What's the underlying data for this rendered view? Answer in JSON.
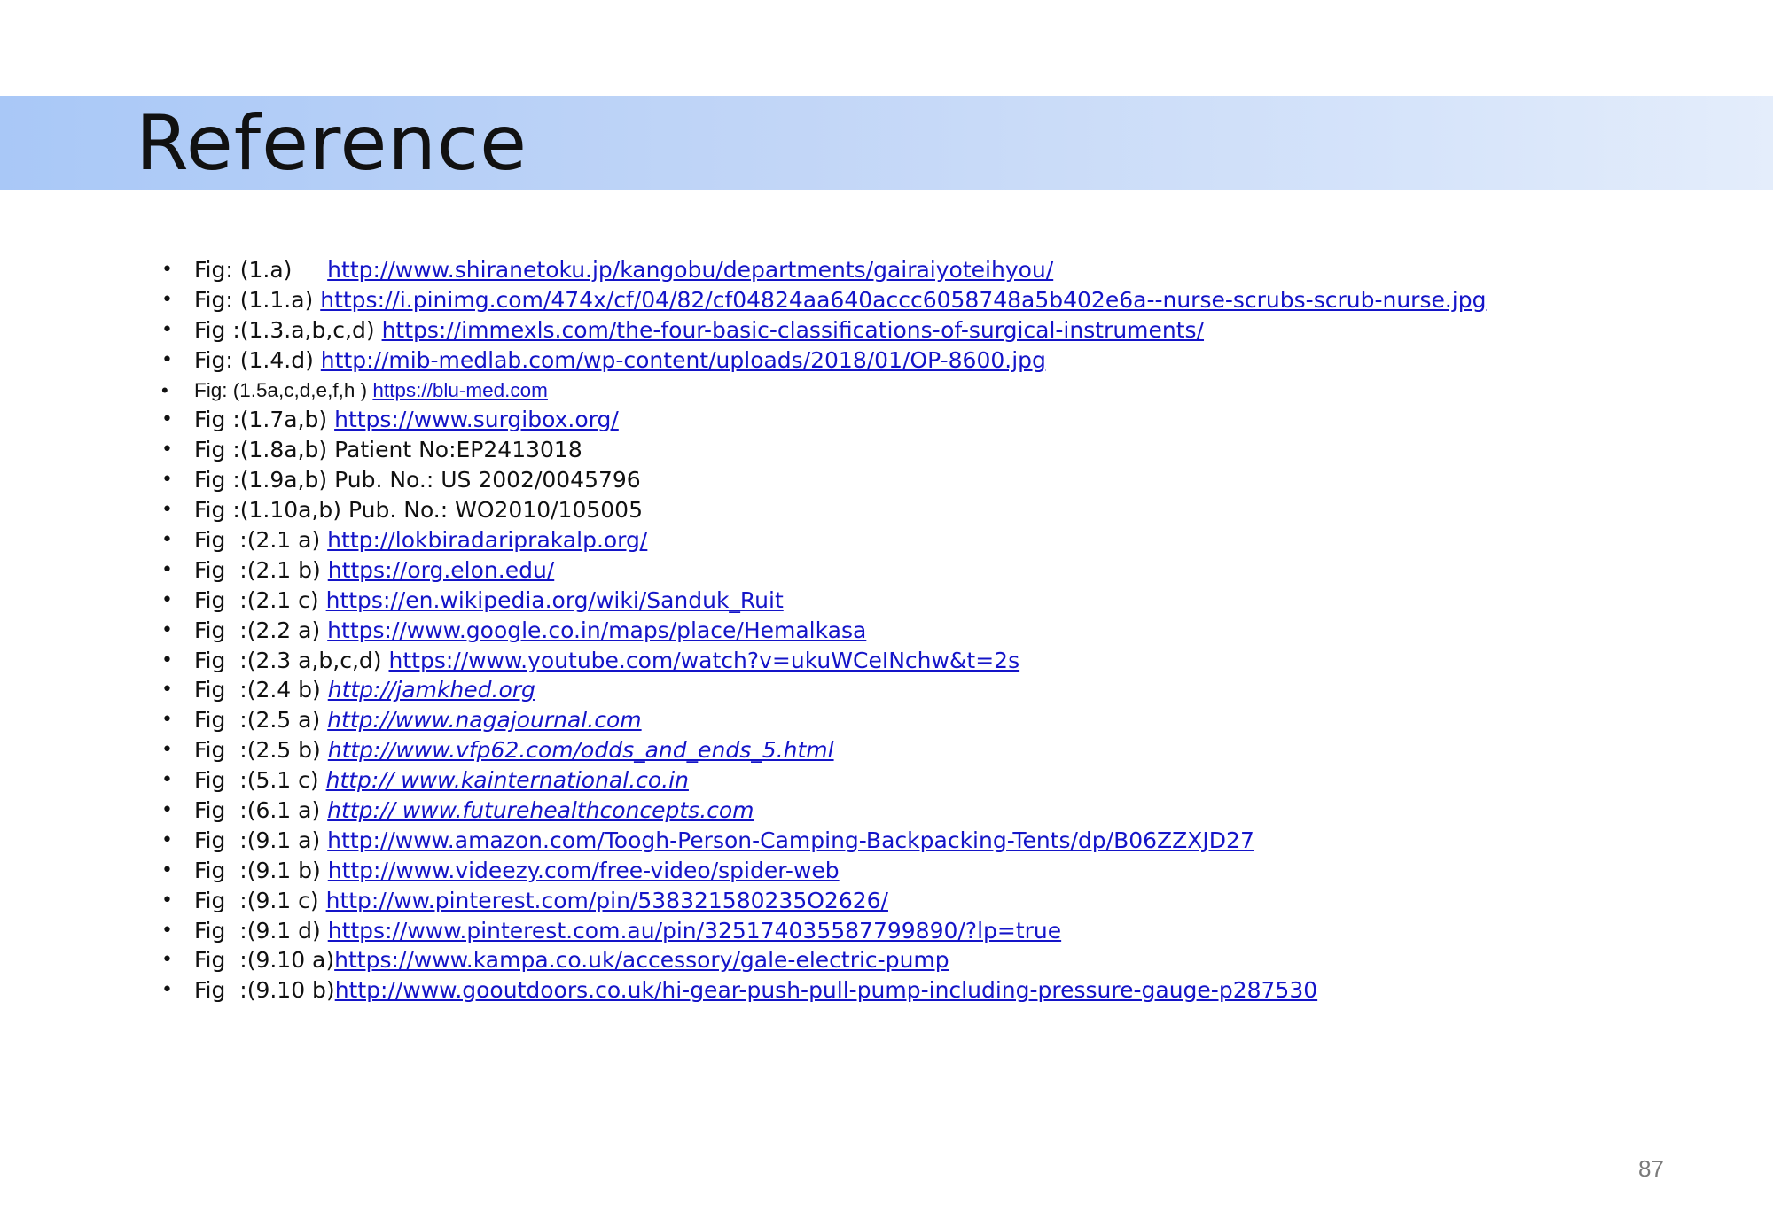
{
  "slide": {
    "title": "Reference",
    "page_number": "87",
    "colors": {
      "title_band_start": "#a9c8f7",
      "title_band_end": "#e4edfb",
      "link": "#1414c8",
      "text": "#111111"
    }
  },
  "references": [
    {
      "label": "Fig: (1.a)     ",
      "link": "http://www.shiranetoku.jp/kangobu/departments/gairaiyoteihyou/",
      "plain": ""
    },
    {
      "label": "Fig: (1.1.a) ",
      "link": "https://i.pinimg.com/474x/cf/04/82/cf04824aa640accc6058748a5b402e6a--nurse-scrubs-scrub-nurse.jpg",
      "plain": ""
    },
    {
      "label": "Fig :(1.3.a,b,c,d) ",
      "link": "https://immexls.com/the-four-basic-classifications-of-surgical-instruments/",
      "plain": ""
    },
    {
      "label": "Fig: (1.4.d) ",
      "link": "http://mib-medlab.com/wp-content/uploads/2018/01/OP-8600.jpg",
      "plain": ""
    },
    {
      "label": "Fig: (1.5a,c,d,e,f,h ) ",
      "link": "https://blu-med.com",
      "plain": ""
    },
    {
      "label": "Fig :(1.7a,b) ",
      "link": "https://www.surgibox.org/",
      "plain": ""
    },
    {
      "label": "Fig :(1.8a,b) ",
      "link": "",
      "plain": "Patient No:EP2413018"
    },
    {
      "label": "Fig :(1.9a,b) ",
      "link": "",
      "plain": "Pub. No.: US 2002/0045796"
    },
    {
      "label": "Fig :(1.10a,b) ",
      "link": "",
      "plain": "Pub. No.: WO2010/105005"
    },
    {
      "label": "Fig  :(2.1 a) ",
      "link": "http://lokbiradariprakalp.org/",
      "plain": ""
    },
    {
      "label": "Fig  :(2.1 b) ",
      "link": "https://org.elon.edu/",
      "plain": ""
    },
    {
      "label": "Fig  :(2.1 c) ",
      "link": "https://en.wikipedia.org/wiki/Sanduk_Ruit",
      "plain": ""
    },
    {
      "label": "Fig  :(2.2 a) ",
      "link": "https://www.google.co.in/maps/place/Hemalkasa",
      "plain": ""
    },
    {
      "label": "Fig  :(2.3 a,b,c,d) ",
      "link": "https://www.youtube.com/watch?v=ukuWCeINchw&t=2s",
      "plain": ""
    },
    {
      "label": "Fig  :(2.4 b) ",
      "link": "http://jamkhed.org",
      "plain": ""
    },
    {
      "label": "Fig  :(2.5 a) ",
      "link": "http://www.nagajournal.com",
      "plain": ""
    },
    {
      "label": "Fig  :(2.5 b) ",
      "link": "http://www.vfp62.com/odds_and_ends_5.html",
      "plain": ""
    },
    {
      "label": "Fig  :(5.1 c) ",
      "link": "http:// www.kainternational.co.in",
      "plain": ""
    },
    {
      "label": "Fig  :(6.1 a) ",
      "link": "http:// www.futurehealthconcepts.com",
      "plain": ""
    },
    {
      "label": "Fig  :(9.1 a) ",
      "link": "http://www.amazon.com/Toogh-Person-Camping-Backpacking-Tents/dp/B06ZZXJD27",
      "plain": ""
    },
    {
      "label": "Fig  :(9.1 b) ",
      "link": "http://www.videezy.com/free-video/spider-web",
      "plain": ""
    },
    {
      "label": "Fig  :(9.1 c) ",
      "link": "http://ww.pinterest.com/pin/538321580235O2626/",
      "plain": ""
    },
    {
      "label": "Fig  :(9.1 d) ",
      "link": "https://www.pinterest.com.au/pin/325174035587799890/?lp=true",
      "plain": ""
    },
    {
      "label": "Fig  :(9.10 a)",
      "link": "https://www.kampa.co.uk/accessory/gale-electric-pump",
      "plain": ""
    },
    {
      "label": "Fig  :(9.10 b)",
      "link": "http://www.gooutdoors.co.uk/hi-gear-push-pull-pump-including-pressure-gauge-p287530",
      "plain": ""
    }
  ]
}
